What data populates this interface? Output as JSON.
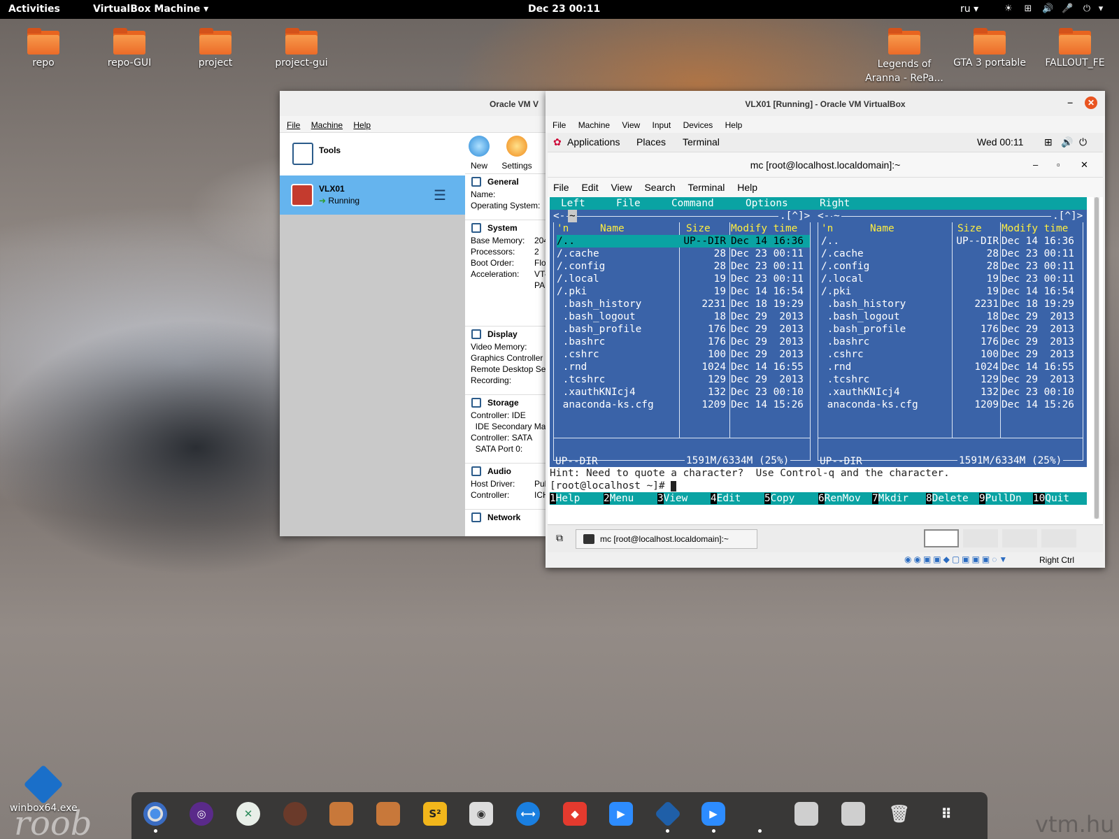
{
  "topbar": {
    "activities": "Activities",
    "app_menu": "VirtualBox Machine",
    "app_menu_arrow": "▾",
    "clock": "Dec 23  00:11",
    "lang": "ru ▾",
    "power_arrow": "▾"
  },
  "desktop": {
    "icons": [
      {
        "label": "repo"
      },
      {
        "label": "repo-GUI"
      },
      {
        "label": "project"
      },
      {
        "label": "project-gui"
      },
      {
        "label": "Legends of Aranna - RePa..."
      },
      {
        "label": "GTA 3 portable"
      },
      {
        "label": "FALLOUT_FE"
      }
    ],
    "winbox": "winbox64.exe",
    "watermark_left": "roob",
    "watermark_right": "vtm.hu"
  },
  "vbox_manager": {
    "title": "Oracle VM V",
    "menu": [
      "File",
      "Machine",
      "Help"
    ],
    "tools_label": "Tools",
    "vm_name": "VLX01",
    "vm_state": "Running",
    "toolbar": {
      "new": "New",
      "settings": "Settings"
    },
    "sections": {
      "general": {
        "title": "General",
        "rows": [
          {
            "k": "Name:",
            "v": ""
          },
          {
            "k": "Operating System:",
            "v": ""
          }
        ]
      },
      "system": {
        "title": "System",
        "rows": [
          {
            "k": "Base Memory:",
            "v": "204"
          },
          {
            "k": "Processors:",
            "v": "2"
          },
          {
            "k": "Boot Order:",
            "v": "Flo"
          },
          {
            "k": "Acceleration:",
            "v": "VT-"
          },
          {
            "k": "",
            "v": "PA"
          }
        ]
      },
      "display": {
        "title": "Display",
        "rows": [
          {
            "k": "Video Memory:",
            "v": ""
          },
          {
            "k": "Graphics Controller",
            "v": ""
          },
          {
            "k": "Remote Desktop Se",
            "v": ""
          },
          {
            "k": "Recording:",
            "v": ""
          }
        ]
      },
      "storage": {
        "title": "Storage",
        "rows": [
          {
            "k": "Controller: IDE",
            "v": ""
          },
          {
            "k": "  IDE Secondary Ma",
            "v": ""
          },
          {
            "k": "Controller: SATA",
            "v": ""
          },
          {
            "k": "  SATA Port 0:",
            "v": ""
          }
        ]
      },
      "audio": {
        "title": "Audio",
        "rows": [
          {
            "k": "Host Driver:",
            "v": "Pulse"
          },
          {
            "k": "Controller:",
            "v": "ICH A"
          }
        ]
      },
      "network": {
        "title": "Network"
      }
    }
  },
  "vm_window": {
    "title": "VLX01 [Running] - Oracle VM VirtualBox",
    "menu": [
      "File",
      "Machine",
      "View",
      "Input",
      "Devices",
      "Help"
    ],
    "guest_top": {
      "applications": "Applications",
      "places": "Places",
      "terminal": "Terminal",
      "clock": "Wed 00:11"
    },
    "terminal": {
      "title": "mc [root@localhost.localdomain]:~",
      "menu": [
        "File",
        "Edit",
        "View",
        "Search",
        "Terminal",
        "Help"
      ],
      "mc_menu": [
        "Left",
        "File",
        "Command",
        "Options",
        "Right"
      ],
      "left_path": "~",
      "right_path": "~",
      "path_corner": ".[^]>",
      "path_open": "<-",
      "col_headers": {
        "n": "'n",
        "name": "Name",
        "size": "Size",
        "mtime": "Modify time"
      },
      "files": [
        {
          "name": "/..",
          "size": "UP--DIR",
          "mtime": "Dec 14 16:36"
        },
        {
          "name": "/.cache",
          "size": "28",
          "mtime": "Dec 23 00:11"
        },
        {
          "name": "/.config",
          "size": "28",
          "mtime": "Dec 23 00:11"
        },
        {
          "name": "/.local",
          "size": "19",
          "mtime": "Dec 23 00:11"
        },
        {
          "name": "/.pki",
          "size": "19",
          "mtime": "Dec 14 16:54"
        },
        {
          "name": " .bash_history",
          "size": "2231",
          "mtime": "Dec 18 19:29"
        },
        {
          "name": " .bash_logout",
          "size": "18",
          "mtime": "Dec 29  2013"
        },
        {
          "name": " .bash_profile",
          "size": "176",
          "mtime": "Dec 29  2013"
        },
        {
          "name": " .bashrc",
          "size": "176",
          "mtime": "Dec 29  2013"
        },
        {
          "name": " .cshrc",
          "size": "100",
          "mtime": "Dec 29  2013"
        },
        {
          "name": " .rnd",
          "size": "1024",
          "mtime": "Dec 14 16:55"
        },
        {
          "name": " .tcshrc",
          "size": "129",
          "mtime": "Dec 29  2013"
        },
        {
          "name": " .xauthKNIcj4",
          "size": "132",
          "mtime": "Dec 23 00:10"
        },
        {
          "name": " anaconda-ks.cfg",
          "size": "1209",
          "mtime": "Dec 14 15:26"
        }
      ],
      "status_left": "UP--DIR",
      "status_right": "UP--DIR",
      "disk_left": "1591M/6334M (25%)",
      "disk_right": "1591M/6334M (25%)",
      "hint": "Hint: Need to quote a character?  Use Control-q and the character.",
      "prompt": "[root@localhost ~]# ",
      "fkeys": [
        {
          "n": "1",
          "l": "Help"
        },
        {
          "n": "2",
          "l": "Menu"
        },
        {
          "n": "3",
          "l": "View"
        },
        {
          "n": "4",
          "l": "Edit"
        },
        {
          "n": "5",
          "l": "Copy"
        },
        {
          "n": "6",
          "l": "RenMov"
        },
        {
          "n": "7",
          "l": "Mkdir"
        },
        {
          "n": "8",
          "l": "Delete"
        },
        {
          "n": "9",
          "l": "PullDn"
        },
        {
          "n": "10",
          "l": "Quit"
        }
      ]
    },
    "taskbar_item": "mc [root@localhost.localdomain]:~",
    "host_key": "Right Ctrl"
  },
  "dock": {
    "apps": [
      "chrome",
      "tor",
      "crossover",
      "game-1",
      "game-2",
      "game-3",
      "sublime",
      "rhythmbox",
      "teamviewer",
      "anydesk",
      "zoom",
      "virtualbox",
      "zoom-2",
      "drive-1",
      "drive-2",
      "trash",
      "app-grid"
    ],
    "glyph_s2": "S²"
  }
}
